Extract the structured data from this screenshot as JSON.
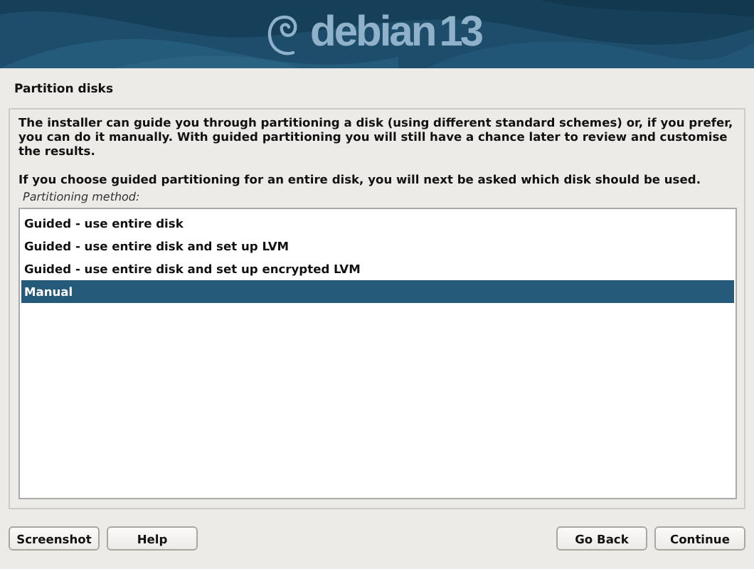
{
  "banner": {
    "brand": "debian",
    "version": "13"
  },
  "title": "Partition disks",
  "description": [
    "The installer can guide you through partitioning a disk (using different standard schemes) or, if you prefer, you can do it manually. With guided partitioning you will still have a chance later to review and customise the results.",
    "If you choose guided partitioning for an entire disk, you will next be asked which disk should be used."
  ],
  "list_label": "Partitioning method:",
  "options": [
    {
      "label": "Guided - use entire disk",
      "selected": false
    },
    {
      "label": "Guided - use entire disk and set up LVM",
      "selected": false
    },
    {
      "label": "Guided - use entire disk and set up encrypted LVM",
      "selected": false
    },
    {
      "label": "Manual",
      "selected": true
    }
  ],
  "buttons_left": [
    "Screenshot",
    "Help"
  ],
  "buttons_right": [
    "Go Back",
    "Continue"
  ]
}
